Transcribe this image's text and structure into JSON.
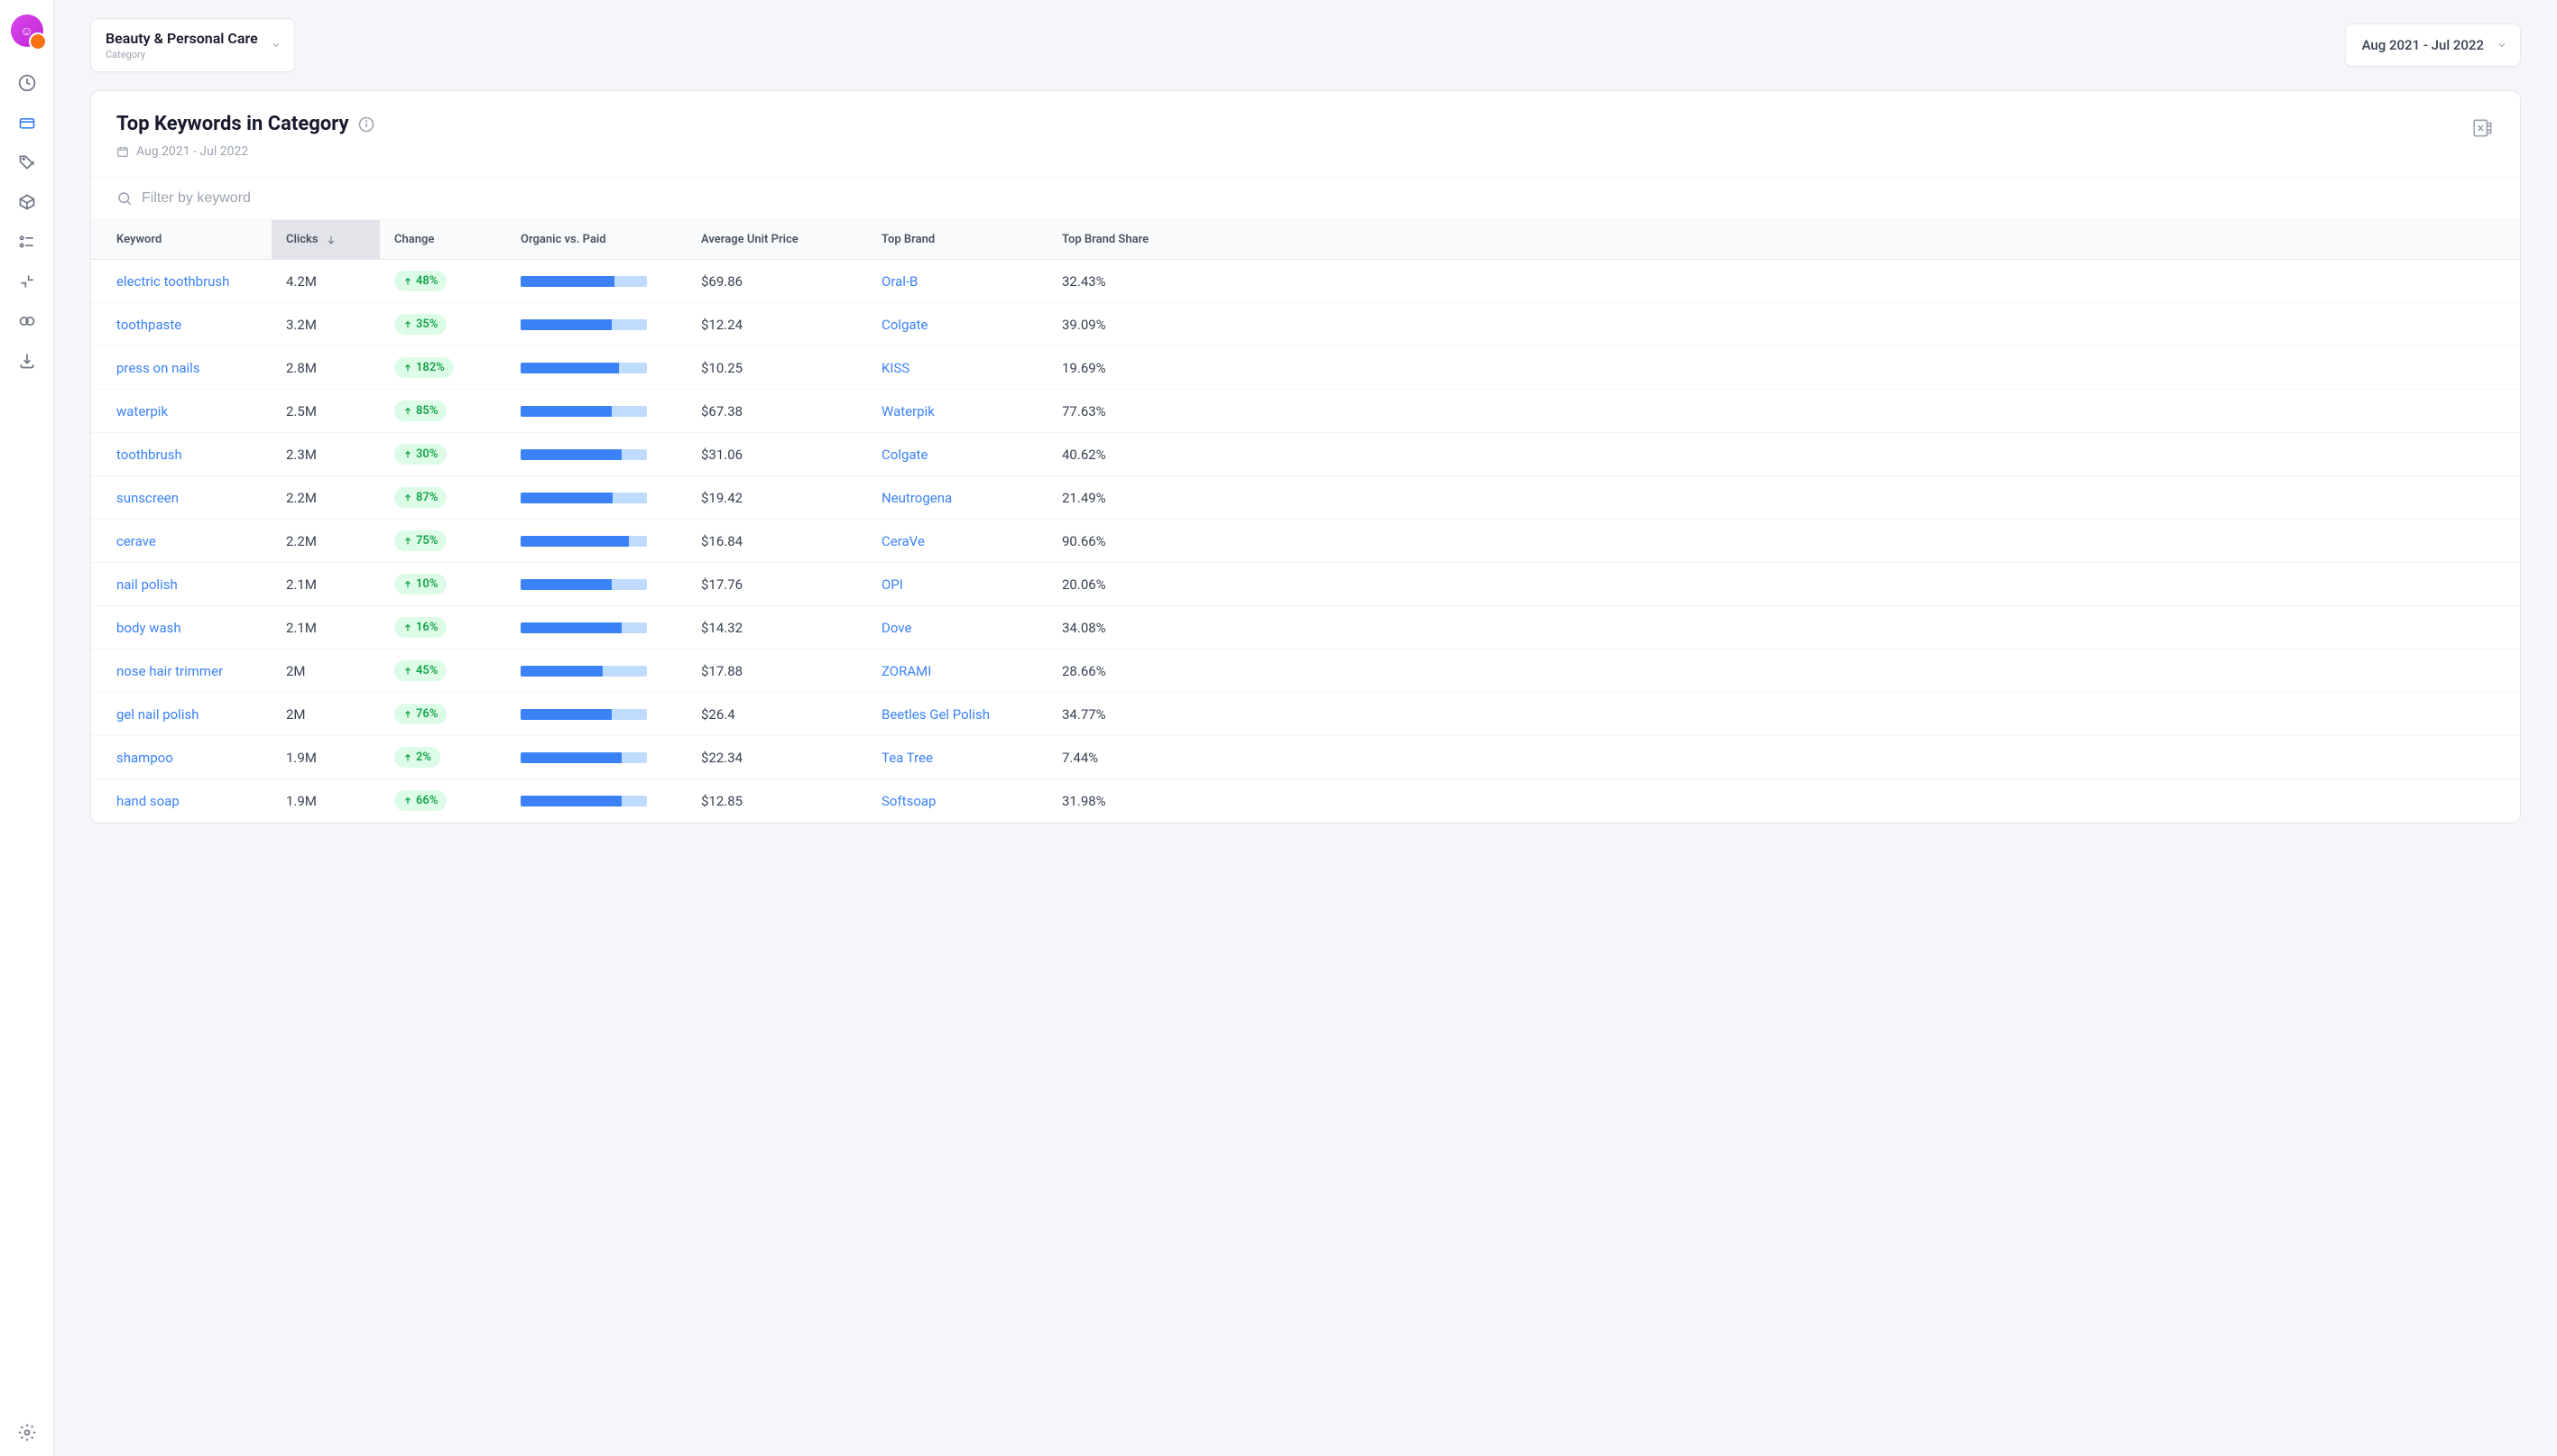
{
  "category_dropdown": {
    "title": "Beauty & Personal Care",
    "subtitle": "Category"
  },
  "date_range": "Aug 2021 - Jul 2022",
  "card": {
    "title": "Top Keywords in Category",
    "date_range": "Aug 2021 - Jul 2022"
  },
  "filter": {
    "placeholder": "Filter by keyword"
  },
  "columns": {
    "keyword": "Keyword",
    "clicks": "Clicks",
    "change": "Change",
    "organic": "Organic vs. Paid",
    "price": "Average Unit Price",
    "brand": "Top Brand",
    "share": "Top Brand Share"
  },
  "rows": [
    {
      "keyword": "electric toothbrush",
      "clicks": "4.2M",
      "change": "48%",
      "organic_pct": 74,
      "price": "$69.86",
      "brand": "Oral-B",
      "share": "32.43%"
    },
    {
      "keyword": "toothpaste",
      "clicks": "3.2M",
      "change": "35%",
      "organic_pct": 72,
      "price": "$12.24",
      "brand": "Colgate",
      "share": "39.09%"
    },
    {
      "keyword": "press on nails",
      "clicks": "2.8M",
      "change": "182%",
      "organic_pct": 78,
      "price": "$10.25",
      "brand": "KISS",
      "share": "19.69%"
    },
    {
      "keyword": "waterpik",
      "clicks": "2.5M",
      "change": "85%",
      "organic_pct": 72,
      "price": "$67.38",
      "brand": "Waterpik",
      "share": "77.63%"
    },
    {
      "keyword": "toothbrush",
      "clicks": "2.3M",
      "change": "30%",
      "organic_pct": 80,
      "price": "$31.06",
      "brand": "Colgate",
      "share": "40.62%"
    },
    {
      "keyword": "sunscreen",
      "clicks": "2.2M",
      "change": "87%",
      "organic_pct": 73,
      "price": "$19.42",
      "brand": "Neutrogena",
      "share": "21.49%"
    },
    {
      "keyword": "cerave",
      "clicks": "2.2M",
      "change": "75%",
      "organic_pct": 86,
      "price": "$16.84",
      "brand": "CeraVe",
      "share": "90.66%"
    },
    {
      "keyword": "nail polish",
      "clicks": "2.1M",
      "change": "10%",
      "organic_pct": 72,
      "price": "$17.76",
      "brand": "OPI",
      "share": "20.06%"
    },
    {
      "keyword": "body wash",
      "clicks": "2.1M",
      "change": "16%",
      "organic_pct": 80,
      "price": "$14.32",
      "brand": "Dove",
      "share": "34.08%"
    },
    {
      "keyword": "nose hair trimmer",
      "clicks": "2M",
      "change": "45%",
      "organic_pct": 65,
      "price": "$17.88",
      "brand": "ZORAMI",
      "share": "28.66%"
    },
    {
      "keyword": "gel nail polish",
      "clicks": "2M",
      "change": "76%",
      "organic_pct": 72,
      "price": "$26.4",
      "brand": "Beetles Gel Polish",
      "share": "34.77%"
    },
    {
      "keyword": "shampoo",
      "clicks": "1.9M",
      "change": "2%",
      "organic_pct": 80,
      "price": "$22.34",
      "brand": "Tea Tree",
      "share": "7.44%"
    },
    {
      "keyword": "hand soap",
      "clicks": "1.9M",
      "change": "66%",
      "organic_pct": 80,
      "price": "$12.85",
      "brand": "Softsoap",
      "share": "31.98%"
    }
  ],
  "chart_data": {
    "type": "table",
    "title": "Top Keywords in Category",
    "date_range": "Aug 2021 - Jul 2022",
    "columns": [
      "Keyword",
      "Clicks",
      "Change",
      "Organic vs. Paid (organic %)",
      "Average Unit Price",
      "Top Brand",
      "Top Brand Share"
    ],
    "data": [
      [
        "electric toothbrush",
        "4.2M",
        "+48%",
        74,
        "$69.86",
        "Oral-B",
        "32.43%"
      ],
      [
        "toothpaste",
        "3.2M",
        "+35%",
        72,
        "$12.24",
        "Colgate",
        "39.09%"
      ],
      [
        "press on nails",
        "2.8M",
        "+182%",
        78,
        "$10.25",
        "KISS",
        "19.69%"
      ],
      [
        "waterpik",
        "2.5M",
        "+85%",
        72,
        "$67.38",
        "Waterpik",
        "77.63%"
      ],
      [
        "toothbrush",
        "2.3M",
        "+30%",
        80,
        "$31.06",
        "Colgate",
        "40.62%"
      ],
      [
        "sunscreen",
        "2.2M",
        "+87%",
        73,
        "$19.42",
        "Neutrogena",
        "21.49%"
      ],
      [
        "cerave",
        "2.2M",
        "+75%",
        86,
        "$16.84",
        "CeraVe",
        "90.66%"
      ],
      [
        "nail polish",
        "2.1M",
        "+10%",
        72,
        "$17.76",
        "OPI",
        "20.06%"
      ],
      [
        "body wash",
        "2.1M",
        "+16%",
        80,
        "$14.32",
        "Dove",
        "34.08%"
      ],
      [
        "nose hair trimmer",
        "2M",
        "+45%",
        65,
        "$17.88",
        "ZORAMI",
        "28.66%"
      ],
      [
        "gel nail polish",
        "2M",
        "+76%",
        72,
        "$26.4",
        "Beetles Gel Polish",
        "34.77%"
      ],
      [
        "shampoo",
        "1.9M",
        "+2%",
        80,
        "$22.34",
        "Tea Tree",
        "7.44%"
      ],
      [
        "hand soap",
        "1.9M",
        "+66%",
        80,
        "$12.85",
        "Softsoap",
        "31.98%"
      ]
    ]
  }
}
